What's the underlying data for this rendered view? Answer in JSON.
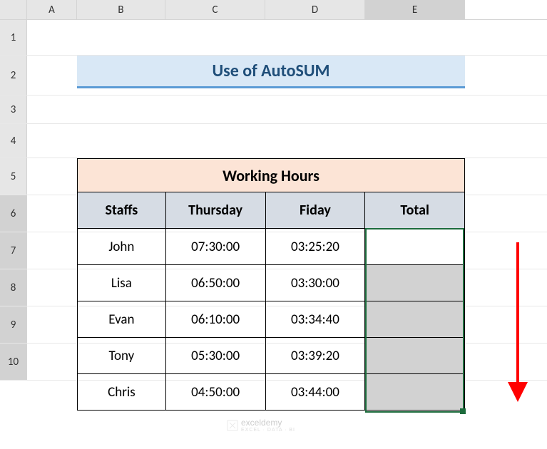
{
  "columns": [
    "A",
    "B",
    "C",
    "D",
    "E"
  ],
  "rows": [
    "1",
    "2",
    "3",
    "4",
    "5",
    "6",
    "7",
    "8",
    "9",
    "10"
  ],
  "title": "Use of AutoSUM",
  "table": {
    "header": "Working Hours",
    "sub": {
      "c1": "Staffs",
      "c2": "Thursday",
      "c3": "Fiday",
      "c4": "Total"
    },
    "data": [
      {
        "name": "John",
        "thu": "07:30:00",
        "fri": "03:25:20",
        "total": ""
      },
      {
        "name": "Lisa",
        "thu": "06:50:00",
        "fri": "03:30:00",
        "total": ""
      },
      {
        "name": "Evan",
        "thu": "06:10:00",
        "fri": "03:34:40",
        "total": ""
      },
      {
        "name": "Tony",
        "thu": "05:30:00",
        "fri": "03:39:20",
        "total": ""
      },
      {
        "name": "Chris",
        "thu": "04:50:00",
        "fri": "03:44:00",
        "total": ""
      }
    ]
  },
  "selected_column": "E",
  "selected_rows": [
    "6",
    "7",
    "8",
    "9",
    "10"
  ],
  "watermark": {
    "brand": "exceldemy",
    "tag": "EXCEL · DATA · BI"
  },
  "chart_data": {
    "type": "table",
    "title": "Working Hours",
    "columns": [
      "Staffs",
      "Thursday",
      "Fiday",
      "Total"
    ],
    "rows": [
      [
        "John",
        "07:30:00",
        "03:25:20",
        ""
      ],
      [
        "Lisa",
        "06:50:00",
        "03:30:00",
        ""
      ],
      [
        "Evan",
        "06:10:00",
        "03:34:40",
        ""
      ],
      [
        "Tony",
        "05:30:00",
        "03:39:20",
        ""
      ],
      [
        "Chris",
        "04:50:00",
        "03:44:00",
        ""
      ]
    ]
  }
}
